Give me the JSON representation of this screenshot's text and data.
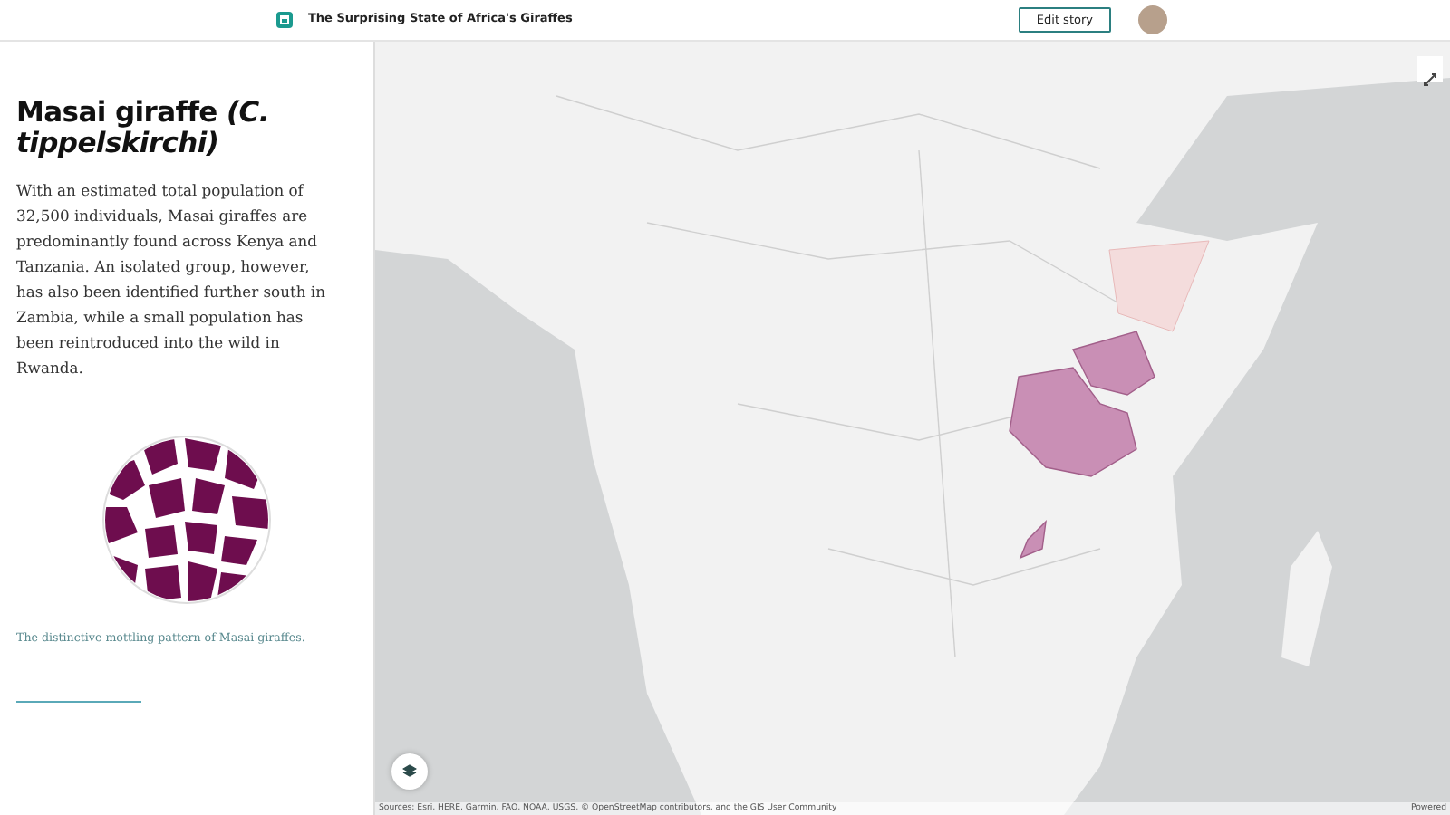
{
  "header": {
    "title": "The Surprising State of Africa's Giraffes",
    "edit_button": "Edit story"
  },
  "panel": {
    "heading": "Masai giraffe *(C. tippelskirchi)*",
    "body": "With an estimated total population of 32,500 individuals, Masai giraffes are predominantly found across Kenya and Tanzania. An isolated group, however, has also been identified further south in Zambia, while a small population has been reintroduced into the wild in Rwanda.",
    "caption": "The distinctive mottling pattern of Masai giraffes."
  },
  "map": {
    "attribution": "Sources: Esri, HERE, Garmin, FAO, NOAA, USGS, © OpenStreetMap contributors, and the GIS User Community",
    "powered": "Powered"
  }
}
